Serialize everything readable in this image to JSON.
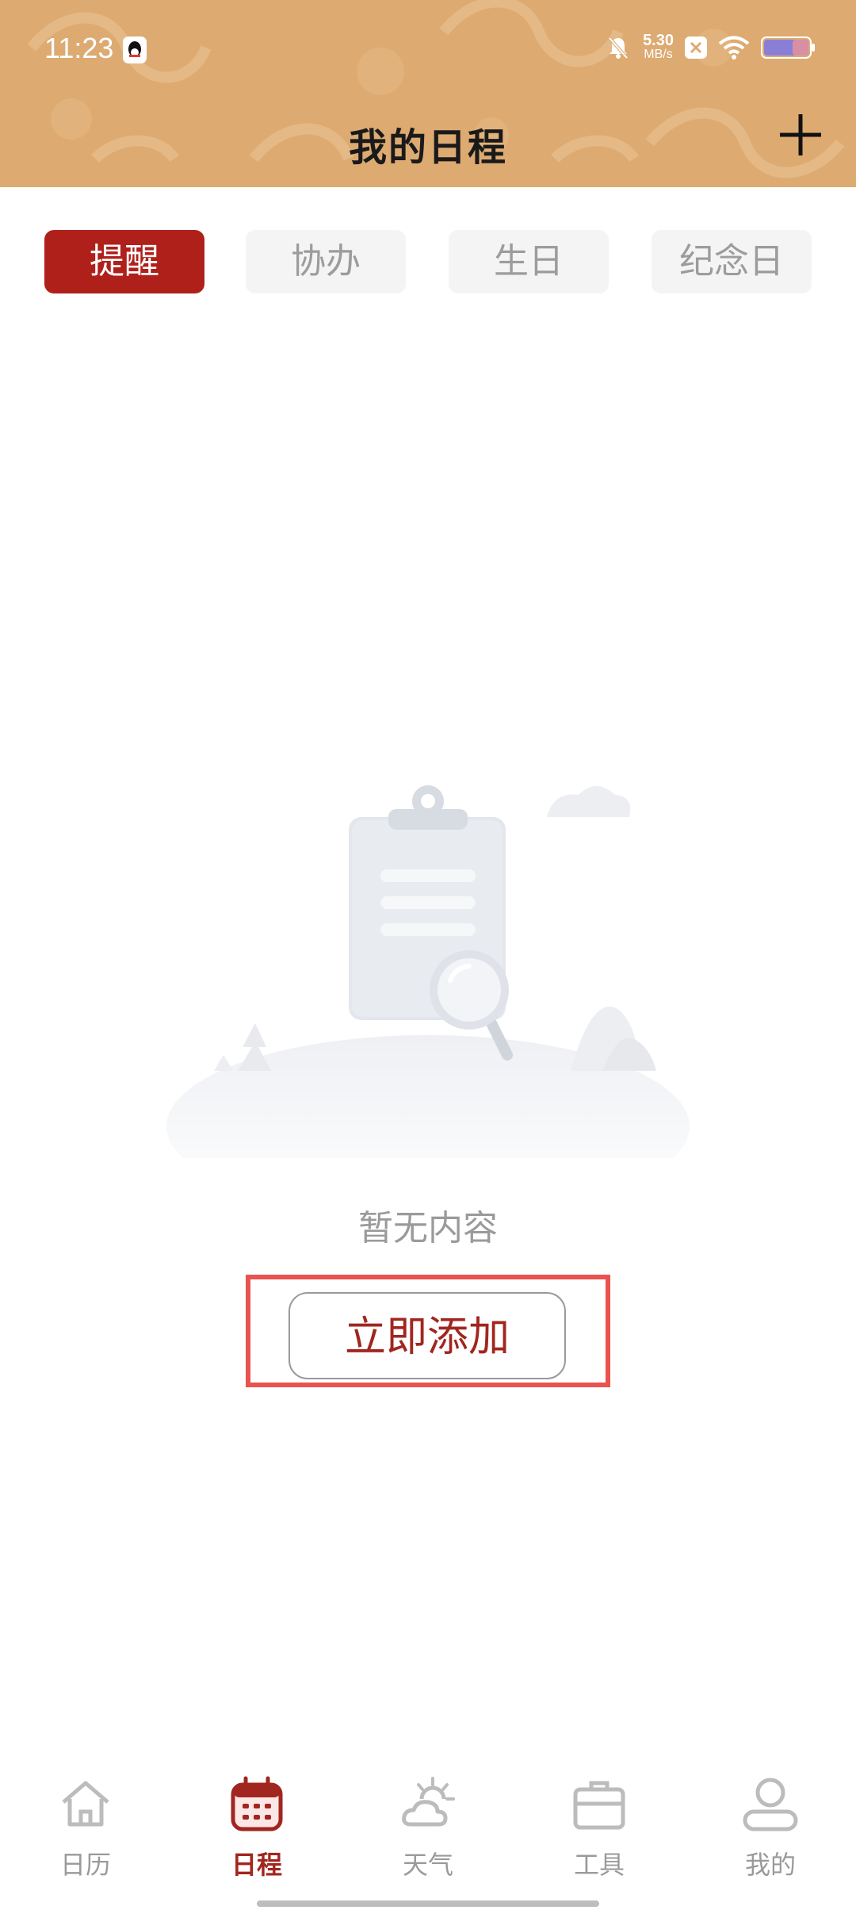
{
  "status_bar": {
    "time": "11:23",
    "net_speed_value": "5.30",
    "net_speed_unit": "MB/s",
    "icons": [
      "qq-icon",
      "bell-muted-icon",
      "x-app-icon",
      "wifi-icon",
      "battery-icon"
    ]
  },
  "header": {
    "title": "我的日程",
    "add_icon": "plus-icon",
    "background_color": "#ddaa71"
  },
  "tabs": [
    {
      "label": "提醒",
      "active": true
    },
    {
      "label": "协办",
      "active": false
    },
    {
      "label": "生日",
      "active": false
    },
    {
      "label": "纪念日",
      "active": false
    }
  ],
  "empty_state": {
    "illustration": "empty-clipboard-illustration",
    "message": "暂无内容",
    "action_label": "立即添加"
  },
  "bottom_nav": [
    {
      "label": "日历",
      "icon": "home-icon",
      "active": false
    },
    {
      "label": "日程",
      "icon": "calendar-icon",
      "active": true
    },
    {
      "label": "天气",
      "icon": "weather-icon",
      "active": false
    },
    {
      "label": "工具",
      "icon": "toolbox-icon",
      "active": false
    },
    {
      "label": "我的",
      "icon": "user-icon",
      "active": false
    }
  ],
  "colors": {
    "accent": "#b0201b",
    "inactive_text": "#9a9a9a",
    "highlight": "#e9534e"
  }
}
